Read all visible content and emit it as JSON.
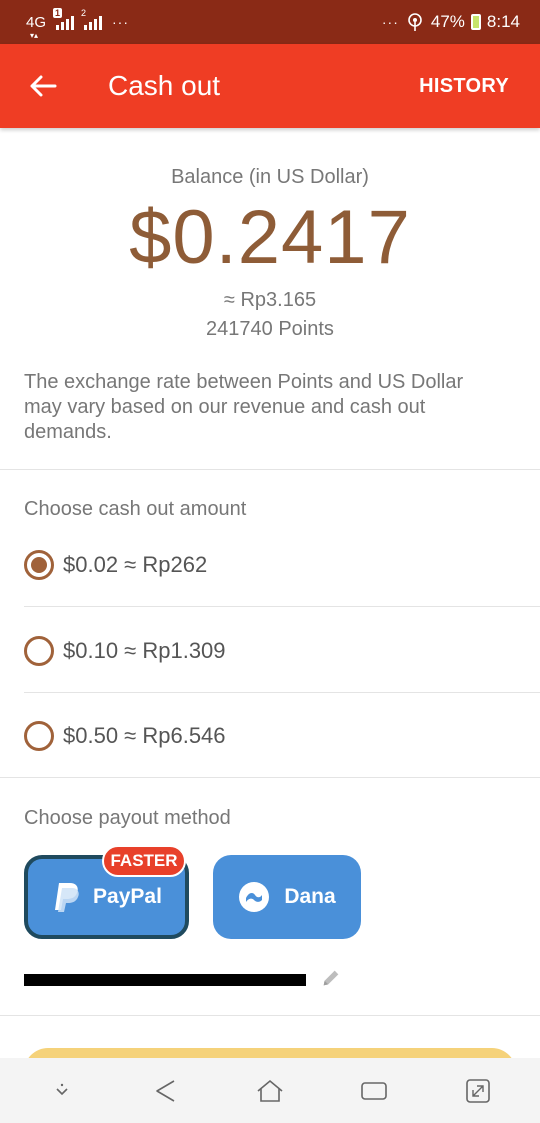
{
  "status_bar": {
    "network": "4G",
    "signal1_badge": "1",
    "signal2_badge": "2",
    "left_dots": "···",
    "right_dots": "···",
    "battery": "47%",
    "time": "8:14"
  },
  "app_bar": {
    "title": "Cash out",
    "history_label": "HISTORY"
  },
  "balance": {
    "label": "Balance (in US Dollar)",
    "amount": "$0.2417",
    "rupiah": "≈ Rp3.165",
    "points": "241740 Points"
  },
  "rate_note": "The exchange rate between Points and US Dollar may vary based on our revenue and cash out demands.",
  "cashout_amount": {
    "title": "Choose cash out amount",
    "options": [
      {
        "label": "$0.02 ≈ Rp262",
        "selected": true
      },
      {
        "label": "$0.10 ≈ Rp1.309",
        "selected": false
      },
      {
        "label": "$0.50 ≈ Rp6.546",
        "selected": false
      }
    ]
  },
  "payout": {
    "title": "Choose payout method",
    "methods": [
      {
        "label": "PayPal",
        "selected": true,
        "badge": "FASTER"
      },
      {
        "label": "Dana",
        "selected": false
      }
    ]
  },
  "colors": {
    "status_bar": "#8a2a16",
    "app_bar": "#ef3d24",
    "balance": "#8e5c37",
    "radio": "#a0623a",
    "payout_blue": "#4a90d9",
    "cashout_button": "#f5d27a"
  },
  "icons": {
    "back": "arrow-left-icon",
    "paypal": "paypal-icon",
    "dana": "dana-icon",
    "edit": "pencil-icon"
  }
}
